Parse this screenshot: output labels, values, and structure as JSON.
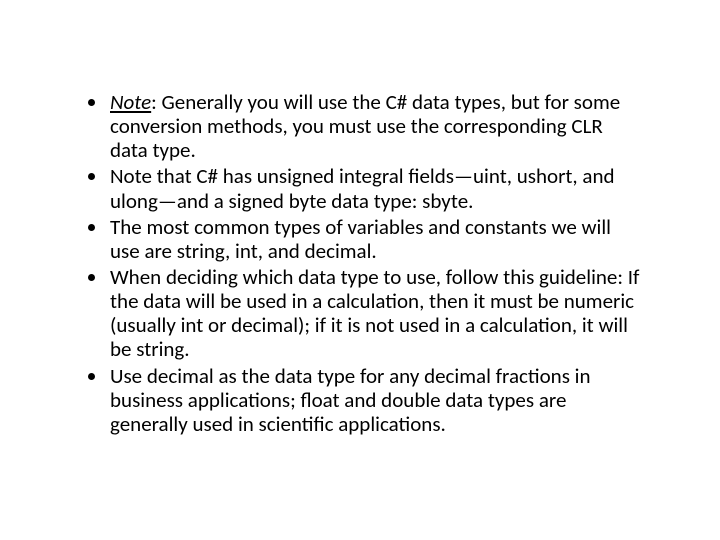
{
  "bullets": [
    {
      "prefix": "Note",
      "prefix_underlined": true,
      "prefix_italic": true,
      "sep": ": ",
      "text": "Generally you will use the C# data types, but for some conversion methods, you must use the corresponding CLR data type."
    },
    {
      "text": "Note that C# has unsigned integral fields—uint, ushort, and ulong—and a signed byte data type: sbyte."
    },
    {
      "text": "The most common types of variables and constants we will use are string, int, and decimal."
    },
    {
      "text": "When deciding which data type to use, follow this guideline: If the data will be used in a calculation, then it must be numeric (usually int or decimal); if it is not used in a calculation, it will be string."
    },
    {
      "text": "Use decimal as the data type for any decimal fractions in business applications; float and double data types are generally used in scientific applications."
    }
  ]
}
